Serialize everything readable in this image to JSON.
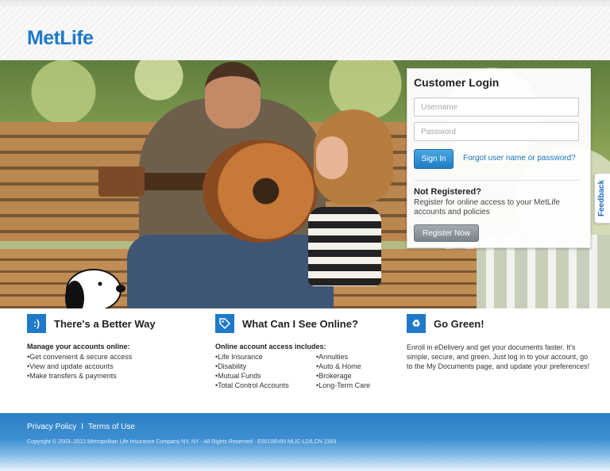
{
  "brand": {
    "logo_text": "MetLife",
    "accent_color": "#1f79c8"
  },
  "login": {
    "title": "Customer Login",
    "username_placeholder": "Username",
    "password_placeholder": "Password",
    "sign_in_label": "Sign In",
    "forgot_link": "Forgot user name or password?",
    "not_registered_title": "Not Registered?",
    "not_registered_text": "Register for online access to your MetLife accounts and policies",
    "register_label": "Register Now"
  },
  "feedback_tab": {
    "label": "Feedback"
  },
  "features": [
    {
      "icon": "smiley-icon",
      "icon_glyph": ":)",
      "title": "There's a Better Way",
      "subtitle": "Manage your accounts online:",
      "items": [
        "Get convenient & secure access",
        "View and update accounts",
        "Make transfers & payments"
      ]
    },
    {
      "icon": "tag-icon",
      "icon_glyph": "⊙",
      "title": "What Can I See Online?",
      "subtitle": "Online account access includes:",
      "items_col1": [
        "Life Insurance",
        "Disability",
        "Mutual Funds",
        "Total Control Accounts"
      ],
      "items_col2": [
        "Annuities",
        "Auto & Home",
        "Brokerage",
        "Long-Term Care"
      ]
    },
    {
      "icon": "recycle-icon",
      "icon_glyph": "♻",
      "title": "Go Green!",
      "text": "Enroll in eDelivery and get your documents faster. It's simple, secure, and green. Just log in to your account, go to the My Documents page, and update your preferences!"
    }
  ],
  "footer": {
    "privacy_label": "Privacy Policy",
    "separator": "I",
    "terms_label": "Terms of Use",
    "copyright": "Copyright © 2003–2012 Metropolitan Life Insurance Company NY, NY - All Rights Reserved - E00108VIN MLIC-LD/LCN 2393"
  }
}
